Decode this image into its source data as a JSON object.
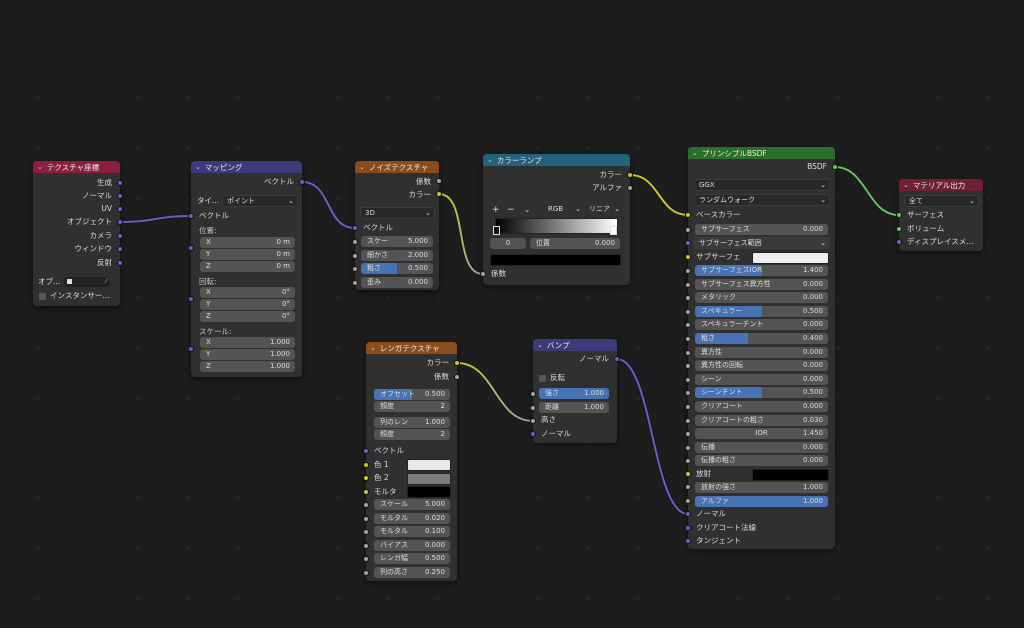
{
  "colors": {
    "texcoord": "#8c1f3f",
    "mapping": "#3e3a7a",
    "noise": "#8a4c1a",
    "ramp": "#24617a",
    "brick": "#8a4c1a",
    "bump": "#3e3a7a",
    "principled": "#2c6e2c",
    "output": "#6e2035"
  },
  "texcoord": {
    "title": "テクスチャ座標",
    "outputs": [
      "生成",
      "ノーマル",
      "UV",
      "オブジェクト",
      "カメラ",
      "ウィンドウ",
      "反射"
    ],
    "object_label": "オブ...",
    "instancer": "インスタンサー..."
  },
  "mapping": {
    "title": "マッピング",
    "output": "ベクトル",
    "type_label": "タイ...",
    "type_value": "ポイント",
    "vector_in": "ベクトル",
    "location": "位置:",
    "rotation": "回転:",
    "scale": "スケール:",
    "loc": [
      {
        "a": "X",
        "v": "0 m"
      },
      {
        "a": "Y",
        "v": "0 m"
      },
      {
        "a": "Z",
        "v": "0 m"
      }
    ],
    "rot": [
      {
        "a": "X",
        "v": "0°"
      },
      {
        "a": "Y",
        "v": "0°"
      },
      {
        "a": "Z",
        "v": "0°"
      }
    ],
    "scl": [
      {
        "a": "X",
        "v": "1.000"
      },
      {
        "a": "Y",
        "v": "1.000"
      },
      {
        "a": "Z",
        "v": "1.000"
      }
    ]
  },
  "noise": {
    "title": "ノイズテクスチャ",
    "out_fac": "係数",
    "out_color": "カラー",
    "dim": "3D",
    "vector": "ベクトル",
    "inputs": [
      {
        "l": "スケー",
        "v": "5.000",
        "f": 0
      },
      {
        "l": "細かさ",
        "v": "2.000",
        "f": 0
      },
      {
        "l": "粗さ",
        "v": "0.500",
        "f": 0.5
      },
      {
        "l": "歪み",
        "v": "0.000",
        "f": 0
      }
    ]
  },
  "ramp": {
    "title": "カラーランプ",
    "out_color": "カラー",
    "out_alpha": "アルファ",
    "mode": "RGB",
    "interp": "リニア",
    "plus": "+",
    "minus": "−",
    "index": "0",
    "pos_label": "位置",
    "pos_value": "0.000",
    "fac": "係数"
  },
  "principled": {
    "title": "プリンシプルBSDF",
    "out": "BSDF",
    "dist": "GGX",
    "sss_method": "ランダムウォーク",
    "base_color": "ベースカラー",
    "sss": {
      "l": "サブサーフェス",
      "v": "0.000"
    },
    "sss_radius": "サブサーフェス範囲",
    "sss_color": "サブサーフェ",
    "fields": [
      {
        "l": "サブサーフェスIOR",
        "v": "1.400",
        "f": 0.5
      },
      {
        "l": "サブサーフェス異方性",
        "v": "0.000",
        "f": 0
      },
      {
        "l": "メタリック",
        "v": "0.000",
        "f": 0
      },
      {
        "l": "スペキュラー",
        "v": "0.500",
        "f": 0.5
      },
      {
        "l": "スペキュラーチント",
        "v": "0.000",
        "f": 0
      },
      {
        "l": "粗さ",
        "v": "0.400",
        "f": 0.4
      },
      {
        "l": "異方性",
        "v": "0.000",
        "f": 0
      },
      {
        "l": "異方性の回転",
        "v": "0.000",
        "f": 0
      },
      {
        "l": "シーン",
        "v": "0.000",
        "f": 0
      },
      {
        "l": "シーンチント",
        "v": "0.500",
        "f": 0.5
      },
      {
        "l": "クリアコート",
        "v": "0.000",
        "f": 0
      },
      {
        "l": "クリアコートの粗さ",
        "v": "0.030",
        "f": 0
      },
      {
        "l": "IOR",
        "v": "1.450",
        "f": 0
      },
      {
        "l": "伝播",
        "v": "0.000",
        "f": 0
      },
      {
        "l": "伝播の粗さ",
        "v": "0.000",
        "f": 0
      }
    ],
    "emission": "放射",
    "emission_strength": {
      "l": "放射の強さ",
      "v": "1.000"
    },
    "alpha": {
      "l": "アルファ",
      "v": "1.000"
    },
    "normal": "ノーマル",
    "clearcoat_normal": "クリアコート法線",
    "tangent": "タンジェント"
  },
  "output": {
    "title": "マテリアル出力",
    "target": "全て",
    "inputs": [
      "サーフェス",
      "ボリューム",
      "ディスプレイスメ..."
    ]
  },
  "brick": {
    "title": "レンガテクスチャ",
    "out_color": "カラー",
    "out_fac": "係数",
    "fields": [
      {
        "l": "オフセット",
        "v": "0.500",
        "f": 0.5
      },
      {
        "l": "頻度",
        "v": "2",
        "f": 0
      },
      {
        "l": "列のレン",
        "v": "1.000",
        "f": 0
      },
      {
        "l": "頻度",
        "v": "2",
        "f": 0
      }
    ],
    "vector": "ベクトル",
    "color1": "色 1",
    "color2": "色 2",
    "mortar": "モルタ",
    "inputs": [
      {
        "l": "スケール",
        "v": "5.000"
      },
      {
        "l": "モルタル",
        "v": "0.020"
      },
      {
        "l": "モルタル",
        "v": "0.100"
      },
      {
        "l": "バイアス",
        "v": "0.000"
      },
      {
        "l": "レンガ幅",
        "v": "0.500"
      },
      {
        "l": "列の高さ",
        "v": "0.250"
      }
    ]
  },
  "bump": {
    "title": "バンプ",
    "out": "ノーマル",
    "invert": "反転",
    "fields": [
      {
        "l": "強さ",
        "v": "1.000",
        "f": 1
      },
      {
        "l": "距離",
        "v": "1.000",
        "f": 0
      }
    ],
    "height": "高さ",
    "normal": "ノーマル"
  }
}
